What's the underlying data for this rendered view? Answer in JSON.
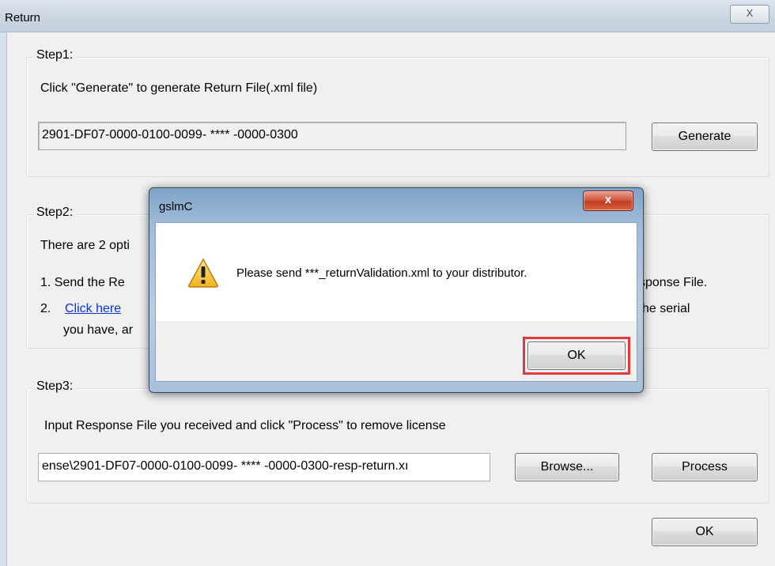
{
  "window": {
    "title": "Return",
    "close_glyph": "X"
  },
  "step1": {
    "legend": "Step1:",
    "instruction": "Click \"Generate\" to generate Return File(.xml file)",
    "serial_value": "2901-DF07-0000-0100-0099- **** -0000-0300",
    "generate_label": "Generate"
  },
  "step2": {
    "legend": "Step2:",
    "intro": "There are 2 opti",
    "option1_prefix": "1.  Send the Re",
    "option1_suffix": "sponse File.",
    "option2_prefix": "2.",
    "option2_link": "Click here",
    "option2_suffix": "he serial",
    "option2_line2": "you have, ar"
  },
  "step3": {
    "legend": "Step3:",
    "instruction": "Input Response File you received and click \"Process\" to remove license",
    "file_value": "ense\\2901-DF07-0000-0100-0099- **** -0000-0300-resp-return.xı",
    "browse_label": "Browse...",
    "process_label": "Process"
  },
  "main_ok_label": "OK",
  "dialog": {
    "title": "gslmC",
    "close_glyph": "x",
    "icon": "warning-icon",
    "message": "Please send ***_returnValidation.xml to your distributor.",
    "ok_label": "OK"
  },
  "colors": {
    "highlight": "#e0393e",
    "link": "#0a34d8"
  }
}
